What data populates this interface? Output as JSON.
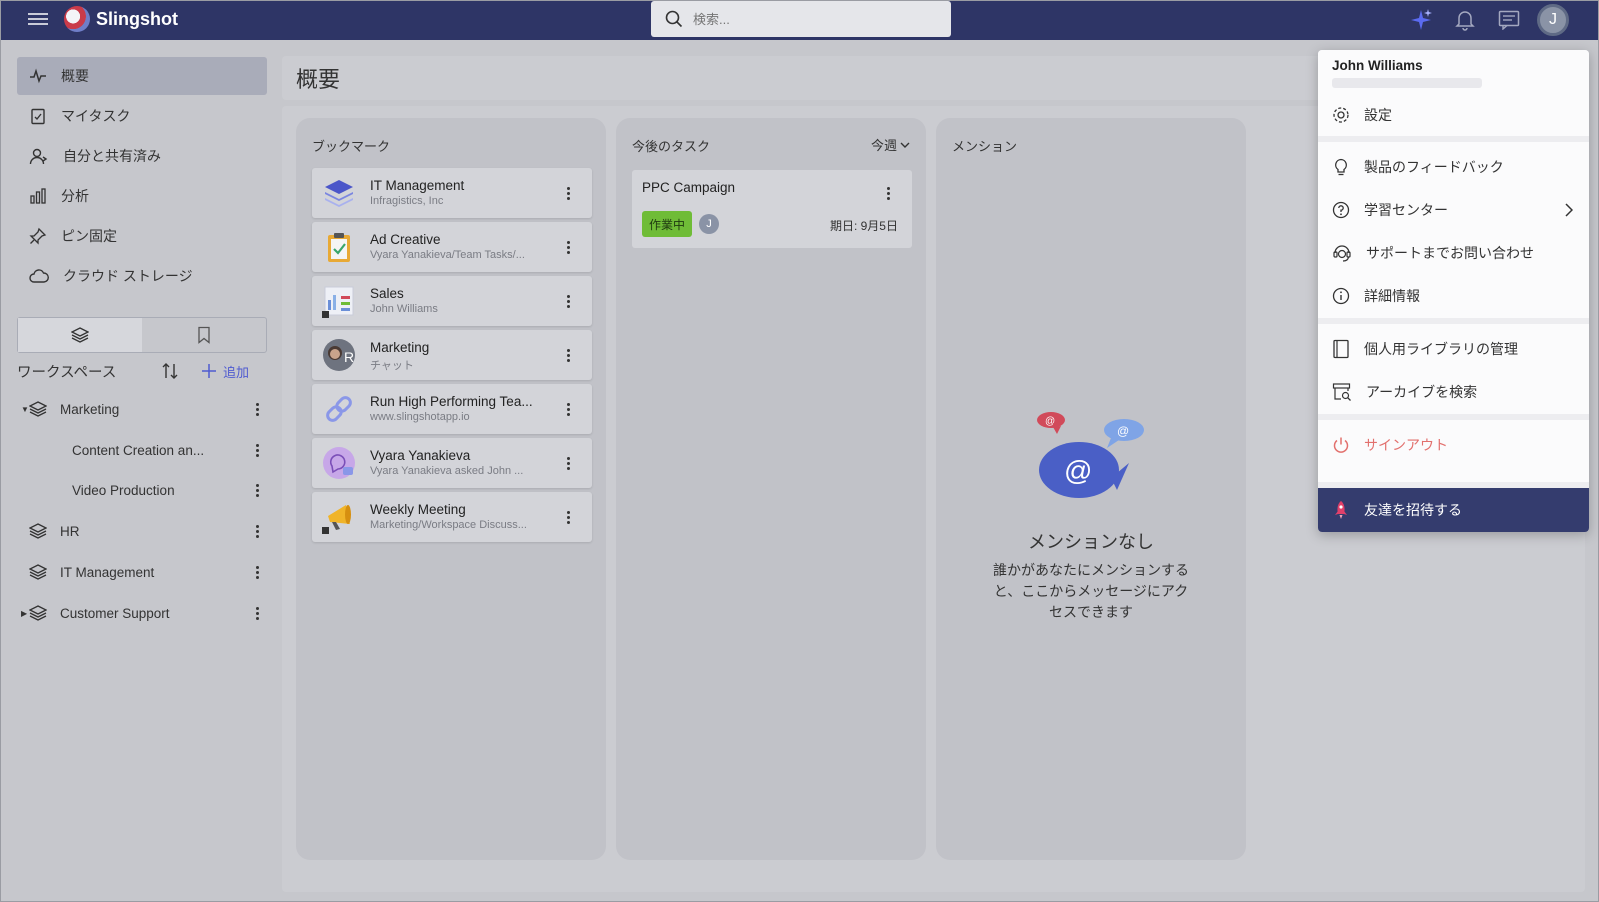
{
  "topbar": {
    "app_name": "Slingshot",
    "search_placeholder": "検索...",
    "avatar_initial": "J"
  },
  "sidebar": {
    "nav": [
      "概要",
      "マイタスク",
      "自分と共有済み",
      "分析",
      "ピン固定",
      "クラウド ストレージ"
    ],
    "workspace_label": "ワークスペース",
    "add_label": "追加",
    "workspaces": [
      {
        "name": "Marketing"
      },
      {
        "name": "Content Creation an..."
      },
      {
        "name": "Video Production"
      },
      {
        "name": "HR"
      },
      {
        "name": "IT Management"
      },
      {
        "name": "Customer Support"
      }
    ]
  },
  "main": {
    "title": "概要",
    "bookmarks": {
      "title": "ブックマーク",
      "items": [
        {
          "title": "IT Management",
          "sub": "Infragistics, Inc"
        },
        {
          "title": "Ad Creative",
          "sub": "Vyara Yanakieva/Team Tasks/..."
        },
        {
          "title": "Sales",
          "sub": "John Williams"
        },
        {
          "title": "Marketing",
          "sub": "チャット"
        },
        {
          "title": "Run High Performing Tea...",
          "sub": "www.slingshotapp.io"
        },
        {
          "title": "Vyara Yanakieva",
          "sub": "Vyara Yanakieva asked John ..."
        },
        {
          "title": "Weekly Meeting",
          "sub": "Marketing/Workspace Discuss..."
        }
      ]
    },
    "tasks": {
      "title": "今後のタスク",
      "filter": "今週",
      "items": [
        {
          "title": "PPC Campaign",
          "status": "作業中",
          "assignee": "J",
          "due": "期日: 9月5日"
        }
      ]
    },
    "mentions": {
      "title": "メンション",
      "empty_title": "メンションなし",
      "empty_line1": "誰かがあなたにメンションする",
      "empty_line2": "と、ここからメッセージにアク",
      "empty_line3": "セスできます"
    }
  },
  "user_menu": {
    "user_name": "John Williams",
    "items": {
      "settings": "設定",
      "feedback": "製品のフィードバック",
      "learning": "学習センター",
      "support": "サポートまでお問い合わせ",
      "about": "詳細情報",
      "library": "個人用ライブラリの管理",
      "archive": "アーカイブを検索",
      "signout": "サインアウト",
      "invite": "友達を招待する"
    }
  },
  "colors": {
    "topbar": "#2e3566",
    "accent": "#4f5bd0",
    "signout": "#e2706d",
    "invite_bg": "#343c6e",
    "status_green": "#6fbc37"
  }
}
